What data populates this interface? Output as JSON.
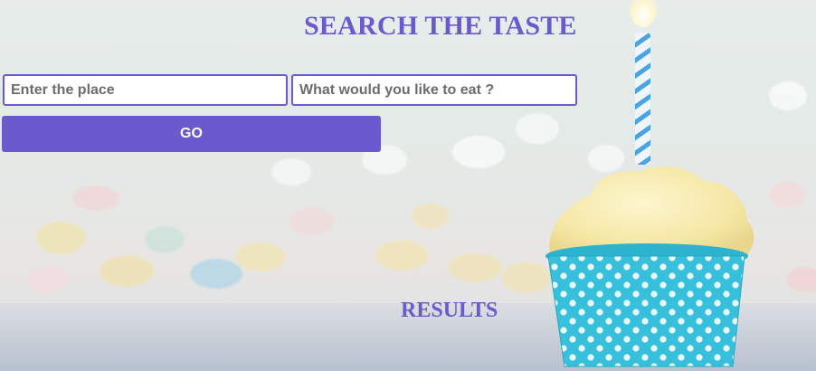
{
  "header": {
    "title": "SEARCH THE TASTE"
  },
  "search": {
    "place_placeholder": "Enter the place",
    "place_value": "",
    "food_placeholder": "What would you like to eat ?",
    "food_value": "",
    "go_label": "GO"
  },
  "results": {
    "heading": "RESULTS"
  },
  "background": {
    "image": "cupcake-with-candle-bokeh"
  },
  "colors": {
    "accent": "#6a5acd",
    "button_text": "#ffffff",
    "input_bg": "#ffffff",
    "cupcake_wrapper": "#3cc2dc",
    "frosting": "#f7eaa8"
  }
}
